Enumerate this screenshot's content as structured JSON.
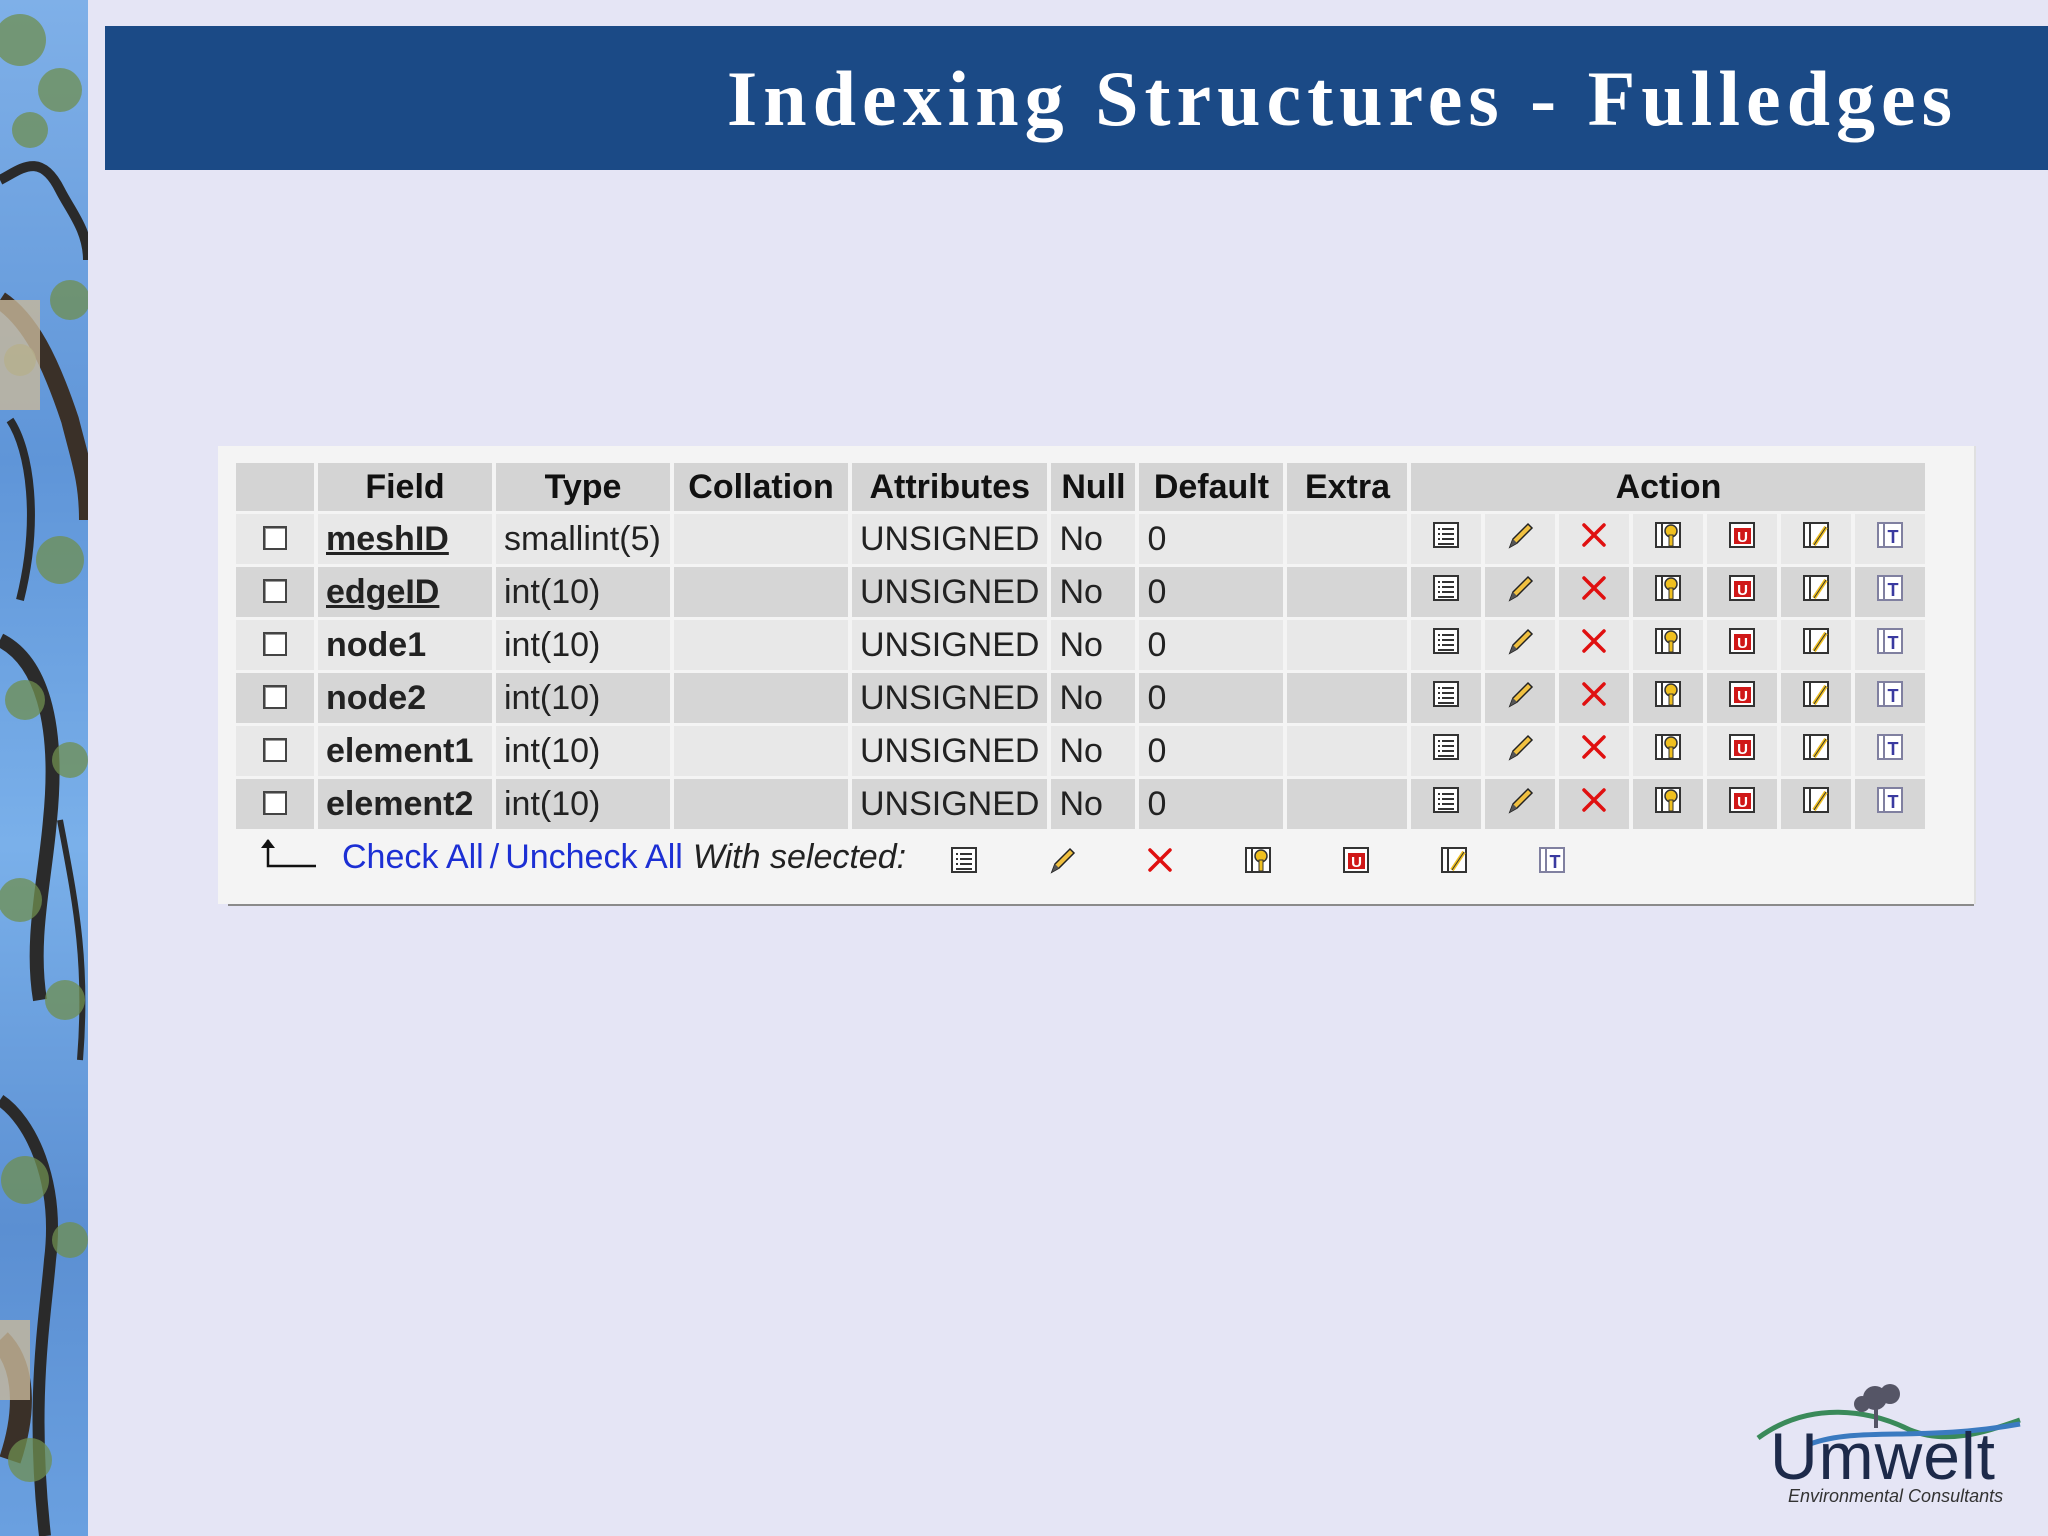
{
  "slide": {
    "title": "Indexing Structures - Fulledges"
  },
  "table": {
    "headers": [
      "",
      "Field",
      "Type",
      "Collation",
      "Attributes",
      "Null",
      "Default",
      "Extra",
      "Action"
    ],
    "rows": [
      {
        "field": "meshID",
        "type": "smallint(5)",
        "collation": "",
        "attributes": "UNSIGNED",
        "null": "No",
        "default": "0",
        "extra": "",
        "linked": true
      },
      {
        "field": "edgeID",
        "type": "int(10)",
        "collation": "",
        "attributes": "UNSIGNED",
        "null": "No",
        "default": "0",
        "extra": "",
        "linked": true
      },
      {
        "field": "node1",
        "type": "int(10)",
        "collation": "",
        "attributes": "UNSIGNED",
        "null": "No",
        "default": "0",
        "extra": "",
        "linked": false
      },
      {
        "field": "node2",
        "type": "int(10)",
        "collation": "",
        "attributes": "UNSIGNED",
        "null": "No",
        "default": "0",
        "extra": "",
        "linked": false
      },
      {
        "field": "element1",
        "type": "int(10)",
        "collation": "",
        "attributes": "UNSIGNED",
        "null": "No",
        "default": "0",
        "extra": "",
        "linked": false
      },
      {
        "field": "element2",
        "type": "int(10)",
        "collation": "",
        "attributes": "UNSIGNED",
        "null": "No",
        "default": "0",
        "extra": "",
        "linked": false
      }
    ],
    "action_icons": [
      "browse-icon",
      "edit-pencil-icon",
      "delete-x-icon",
      "primary-key-icon",
      "unique-icon",
      "index-icon",
      "fulltext-icon"
    ]
  },
  "footer": {
    "check_all": "Check All",
    "separator": "/",
    "uncheck_all": "Uncheck All",
    "with_selected": "With selected:"
  },
  "logo": {
    "name": "Umwelt",
    "subtitle": "Environmental Consultants"
  },
  "colors": {
    "banner": "#1b4a86",
    "background": "#e5e5f5",
    "link": "#1c2fd4",
    "delete_red": "#e01010"
  }
}
